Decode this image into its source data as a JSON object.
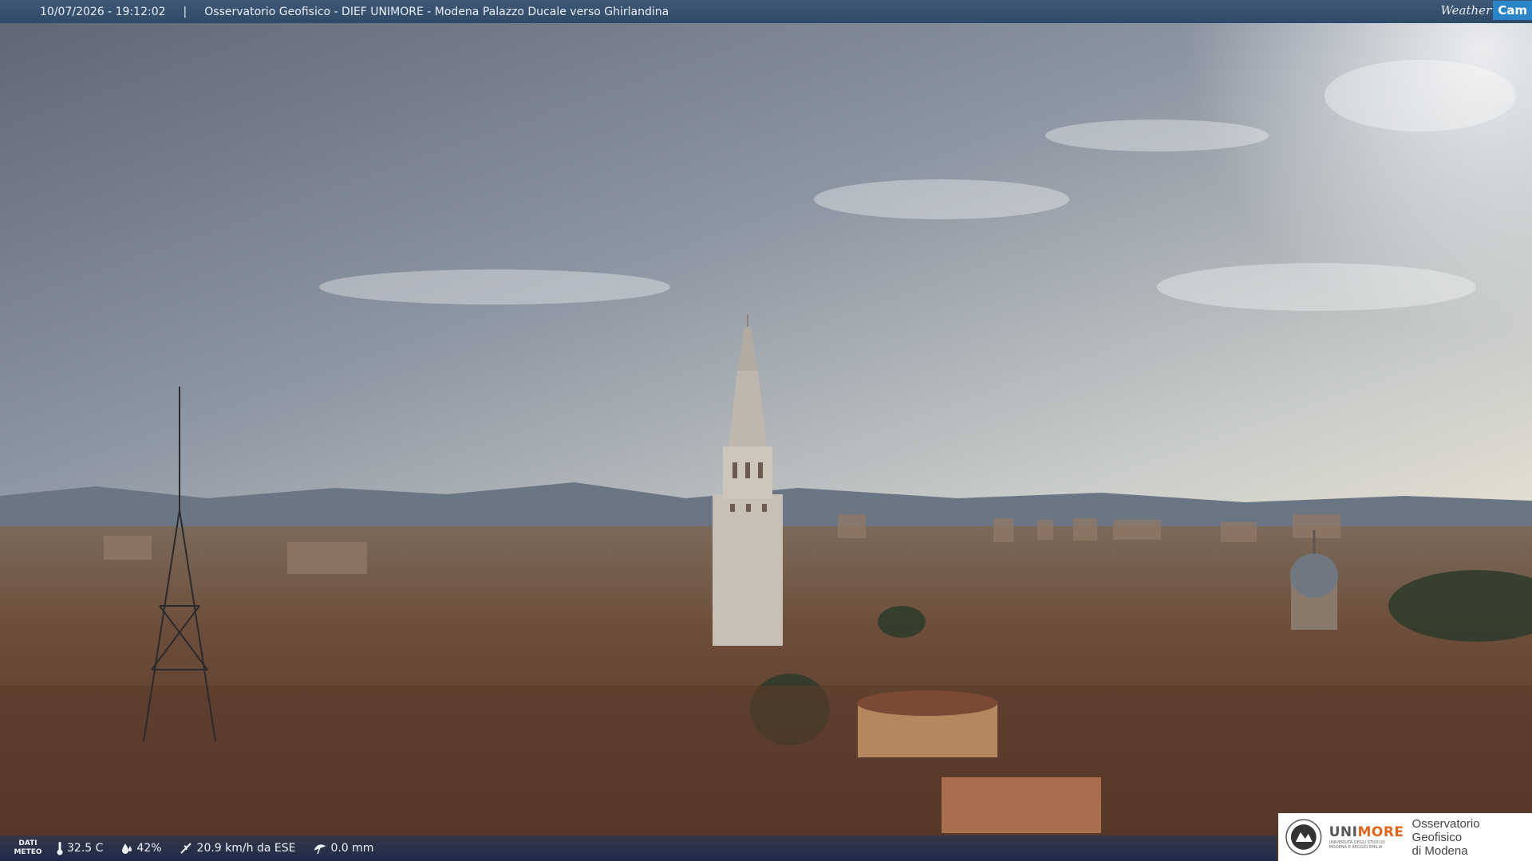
{
  "header": {
    "timestamp": "10/07/2026 - 19:12:02",
    "separator": "|",
    "title": "Osservatorio Geofisico - DIEF UNIMORE - Modena Palazzo Ducale verso Ghirlandina",
    "brand_weather": "Weather",
    "brand_cam": "Cam"
  },
  "weather": {
    "label_line1": "DATI",
    "label_line2": "METEO",
    "temperature": "32.5 C",
    "humidity": "42%",
    "wind": "20.9 km/h da ESE",
    "rain": "0.0 mm"
  },
  "logo": {
    "name_prefix": "UNI",
    "name_suffix": "MORE",
    "subtitle": "UNIVERSITÀ DEGLI STUDI DI MODENA E REGGIO EMILIA",
    "observatory_line1": "Osservatorio Geofisico",
    "observatory_line2": "di Modena"
  },
  "colors": {
    "accent": "#2b86c9",
    "brand_orange": "#e0661b",
    "bar": "#2f4a68"
  }
}
